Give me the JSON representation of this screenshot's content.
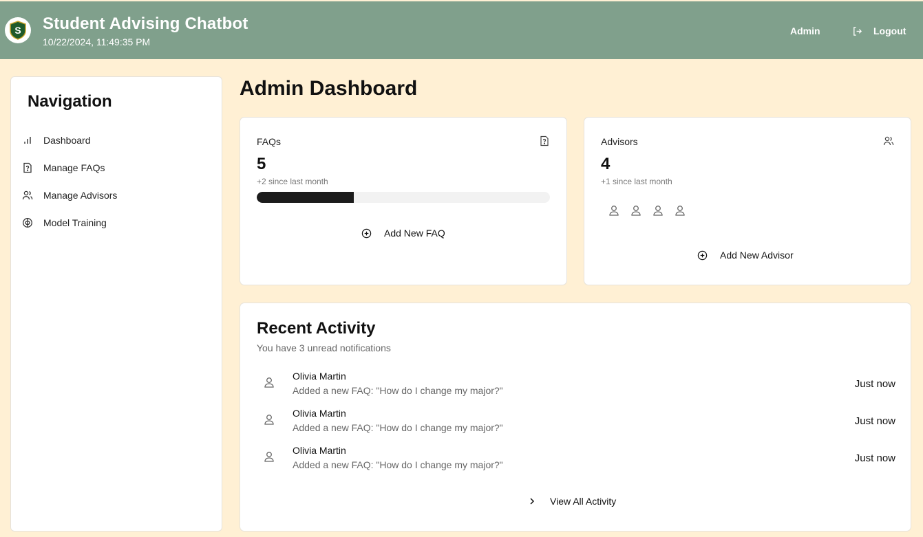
{
  "header": {
    "title": "Student Advising Chatbot",
    "datetime": "10/22/2024, 11:49:35 PM",
    "logo_letter": "S",
    "user": "Admin",
    "logout_label": "Logout",
    "bar_color": "#80a08c"
  },
  "sidebar": {
    "title": "Navigation",
    "items": [
      {
        "label": "Dashboard",
        "icon": "bar-chart-icon"
      },
      {
        "label": "Manage FAQs",
        "icon": "faq-icon"
      },
      {
        "label": "Manage Advisors",
        "icon": "users-icon"
      },
      {
        "label": "Model Training",
        "icon": "brain-icon"
      }
    ]
  },
  "main": {
    "title": "Admin Dashboard",
    "faq_card": {
      "label": "FAQs",
      "count": "5",
      "change": "+2 since last month",
      "progress": 0.33,
      "action": "Add New FAQ"
    },
    "advisor_card": {
      "label": "Advisors",
      "count": "4",
      "change": "+1 since last month",
      "advisor_avatars": 4,
      "action": "Add New Advisor"
    },
    "activity": {
      "title": "Recent Activity",
      "subtitle": "You have 3 unread notifications",
      "items": [
        {
          "name": "Olivia Martin",
          "text": "Added a new FAQ: \"How do I change my major?\"",
          "time": "Just now"
        },
        {
          "name": "Olivia Martin",
          "text": "Added a new FAQ: \"How do I change my major?\"",
          "time": "Just now"
        },
        {
          "name": "Olivia Martin",
          "text": "Added a new FAQ: \"How do I change my major?\"",
          "time": "Just now"
        }
      ],
      "view_all": "View All Activity"
    }
  },
  "colors": {
    "background": "#fff0d4",
    "header": "#80a08c",
    "logo_green": "#1f5a2a",
    "progress_fill": "#1c1c1c"
  }
}
